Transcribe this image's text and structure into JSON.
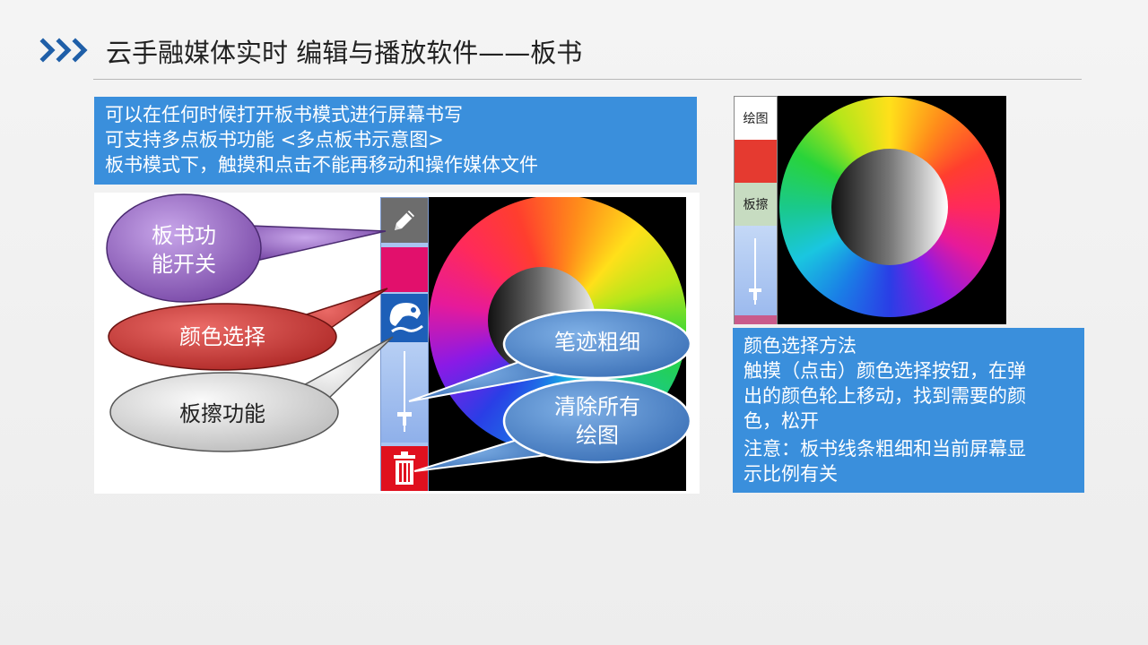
{
  "header": {
    "title": "云手融媒体实时 编辑与播放软件——板书",
    "chevron_icon": "triple-chevron-right-icon",
    "accent_color": "#1f5fa8"
  },
  "intro_box": {
    "lines": [
      "可以在任何时候打开板书模式进行屏幕书写",
      "可支持多点板书功能 <多点板书示意图>",
      "板书模式下，触摸和点击不能再移动和操作媒体文件"
    ],
    "background": "#3a8fdc"
  },
  "toolbar_demo": {
    "buttons": [
      {
        "name": "pen-toggle",
        "icon": "pencil-icon",
        "color": "#6d6d6d"
      },
      {
        "name": "color-select",
        "icon": "color-swatch",
        "color": "#e2106c"
      },
      {
        "name": "eraser",
        "icon": "eraser-icon",
        "color": "#1d5fb8"
      },
      {
        "name": "stroke-width",
        "icon": "slider-icon",
        "color": "#a9c4f0"
      },
      {
        "name": "clear-all",
        "icon": "trash-icon",
        "color": "#e0101e"
      }
    ]
  },
  "callouts": {
    "pen_toggle": {
      "label_line1": "板书功",
      "label_line2": "能开关",
      "color": "#8a5bb5"
    },
    "color_select": {
      "label": "颜色选择",
      "color": "#c0312f"
    },
    "eraser": {
      "label": "板擦功能",
      "color": "#cfcfcf"
    },
    "stroke_width": {
      "label": "笔迹粗细",
      "color": "#4a7fc1"
    },
    "clear_all": {
      "label_line1": "清除所有",
      "label_line2": "绘图",
      "color": "#4a7fc1"
    }
  },
  "right_panel": {
    "draw_label": "绘图",
    "erase_label": "板擦",
    "selected_color": "#e53a30"
  },
  "help_box": {
    "title": "颜色选择方法",
    "lines": [
      "触摸（点击）颜色选择按钮，在弹",
      "出的颜色轮上移动，找到需要的颜",
      "色，松开"
    ],
    "note_lines": [
      "注意：板书线条粗细和当前屏幕显",
      "示比例有关"
    ]
  }
}
